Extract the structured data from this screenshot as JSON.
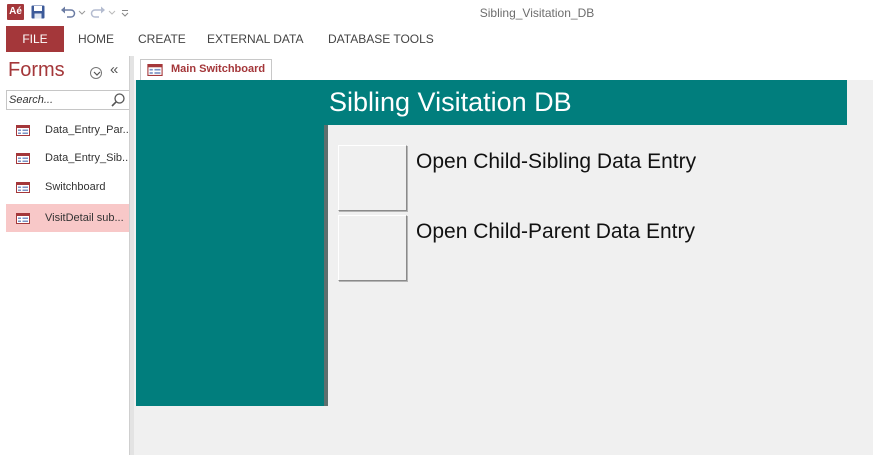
{
  "window": {
    "title": "Sibling_Visitation_DB",
    "app_logo": "Aé"
  },
  "quick_access": {
    "icons": [
      "access-logo-icon",
      "save-icon",
      "undo-icon",
      "redo-icon",
      "customize-qat-icon"
    ]
  },
  "ribbon": {
    "tabs": [
      {
        "label": "FILE"
      },
      {
        "label": "HOME"
      },
      {
        "label": "CREATE"
      },
      {
        "label": "EXTERNAL DATA"
      },
      {
        "label": "DATABASE TOOLS"
      }
    ]
  },
  "nav_pane": {
    "title": "Forms",
    "collapse_glyph": "«",
    "search": {
      "placeholder": "Search...",
      "value": ""
    },
    "items": [
      {
        "label": "Data_Entry_Par...",
        "selected": false
      },
      {
        "label": "Data_Entry_Sib...",
        "selected": false
      },
      {
        "label": "Switchboard",
        "selected": false
      },
      {
        "label": "VisitDetail sub...",
        "selected": true
      }
    ]
  },
  "document": {
    "tab_label": "Main Switchboard",
    "form_title": "Sibling Visitation DB",
    "buttons": [
      {
        "label": "Open Child-Sibling Data Entry"
      },
      {
        "label": "Open Child-Parent Data Entry"
      }
    ]
  },
  "colors": {
    "accent": "#a4373a",
    "teal": "#017e7d",
    "selected_item": "#f8c8c8",
    "canvas": "#f0f0f0"
  }
}
